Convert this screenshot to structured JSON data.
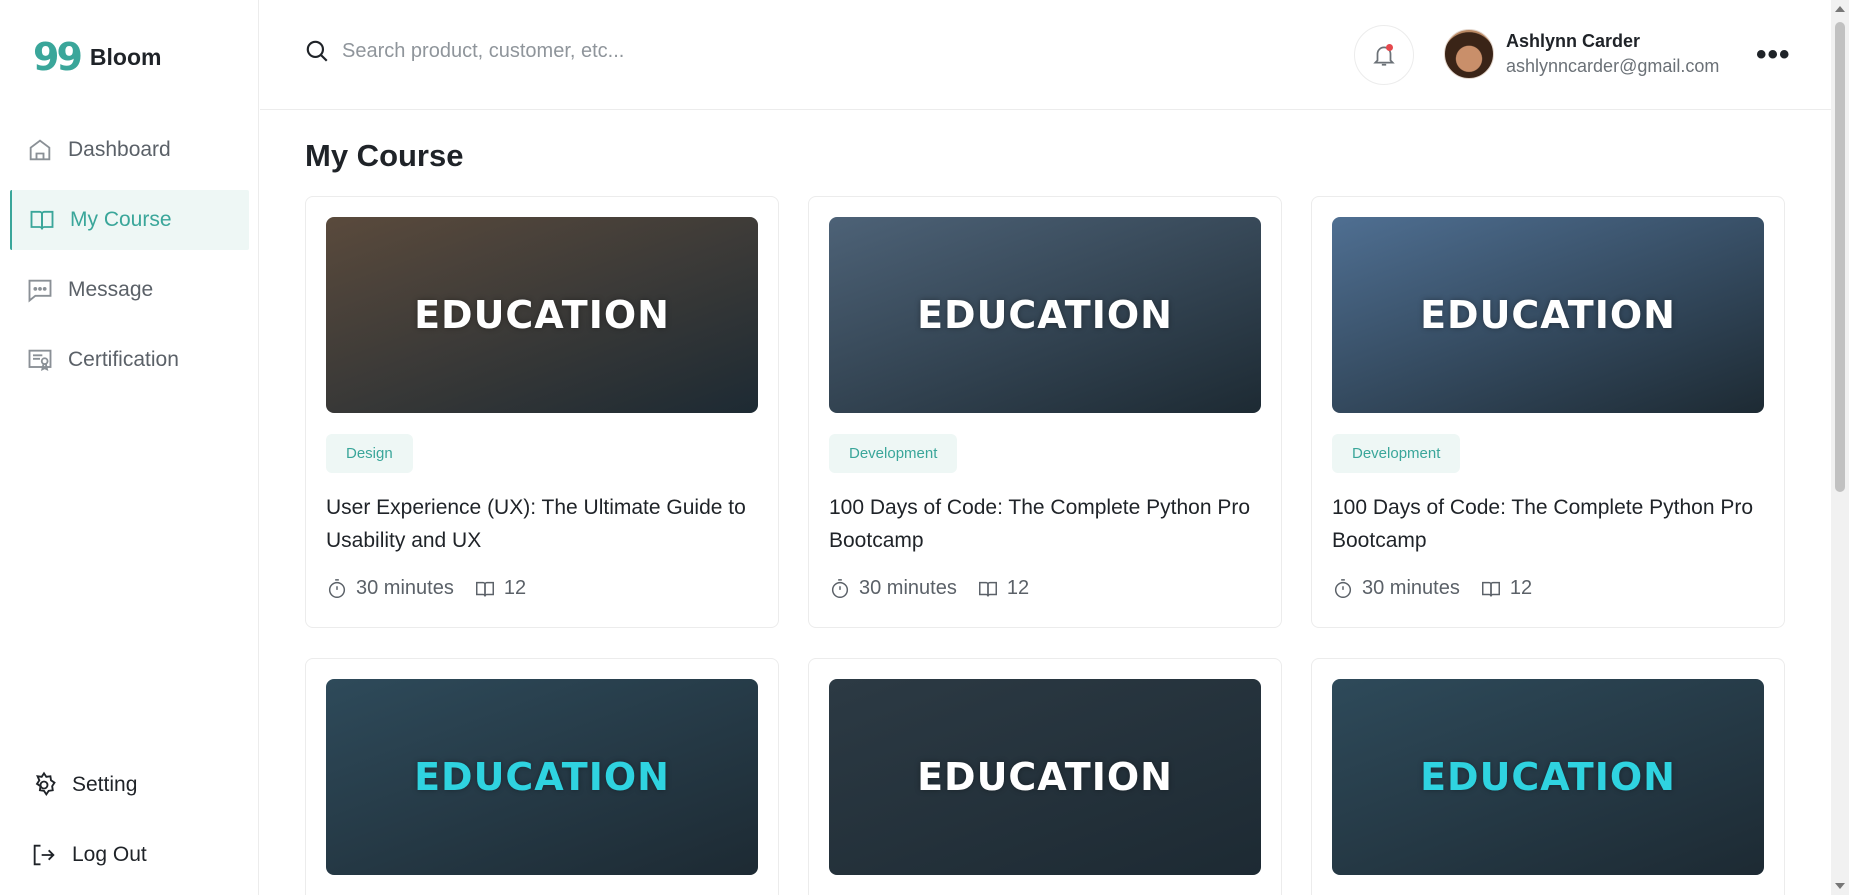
{
  "brand": {
    "logo_mark": "99",
    "name": "Bloom",
    "accent": "#3aa69a"
  },
  "sidebar": {
    "items": [
      {
        "label": "Dashboard",
        "icon": "home-icon",
        "active": false
      },
      {
        "label": "My Course",
        "icon": "book-icon",
        "active": true
      },
      {
        "label": "Message",
        "icon": "message-icon",
        "active": false
      },
      {
        "label": "Certification",
        "icon": "certificate-icon",
        "active": false
      }
    ],
    "bottom": [
      {
        "label": "Setting",
        "icon": "gear-icon"
      },
      {
        "label": "Log Out",
        "icon": "logout-icon"
      }
    ]
  },
  "header": {
    "search_placeholder": "Search product, customer, etc...",
    "user": {
      "name": "Ashlynn Carder",
      "email": "ashlynncarder@gmail.com"
    },
    "more": "•••"
  },
  "page": {
    "title": "My Course"
  },
  "courses": [
    {
      "category": "Design",
      "title": "User Experience (UX): The Ultimate Guide to Usability and UX",
      "duration": "30 minutes",
      "lessons": "12",
      "image_text": "EDUCATION",
      "image_bg": "#5a4a3c"
    },
    {
      "category": "Development",
      "title": "100 Days of Code: The Complete Python Pro Bootcamp",
      "duration": "30 minutes",
      "lessons": "12",
      "image_text": "EDUCATION",
      "image_bg": "#4d6277"
    },
    {
      "category": "Development",
      "title": "100 Days of Code: The Complete Python Pro Bootcamp",
      "duration": "30 minutes",
      "lessons": "12",
      "image_text": "EDUCATION",
      "image_bg": "#4f6f92"
    },
    {
      "category": "",
      "title": "",
      "duration": "",
      "lessons": "",
      "image_text": "EDUCATION",
      "image_bg": "#2e4a5a"
    },
    {
      "category": "",
      "title": "",
      "duration": "",
      "lessons": "",
      "image_text": "EDUCATION",
      "image_bg": "#2c3a44"
    },
    {
      "category": "",
      "title": "",
      "duration": "",
      "lessons": "",
      "image_text": "EDUCATION",
      "image_bg": "#2e4a5a"
    }
  ]
}
